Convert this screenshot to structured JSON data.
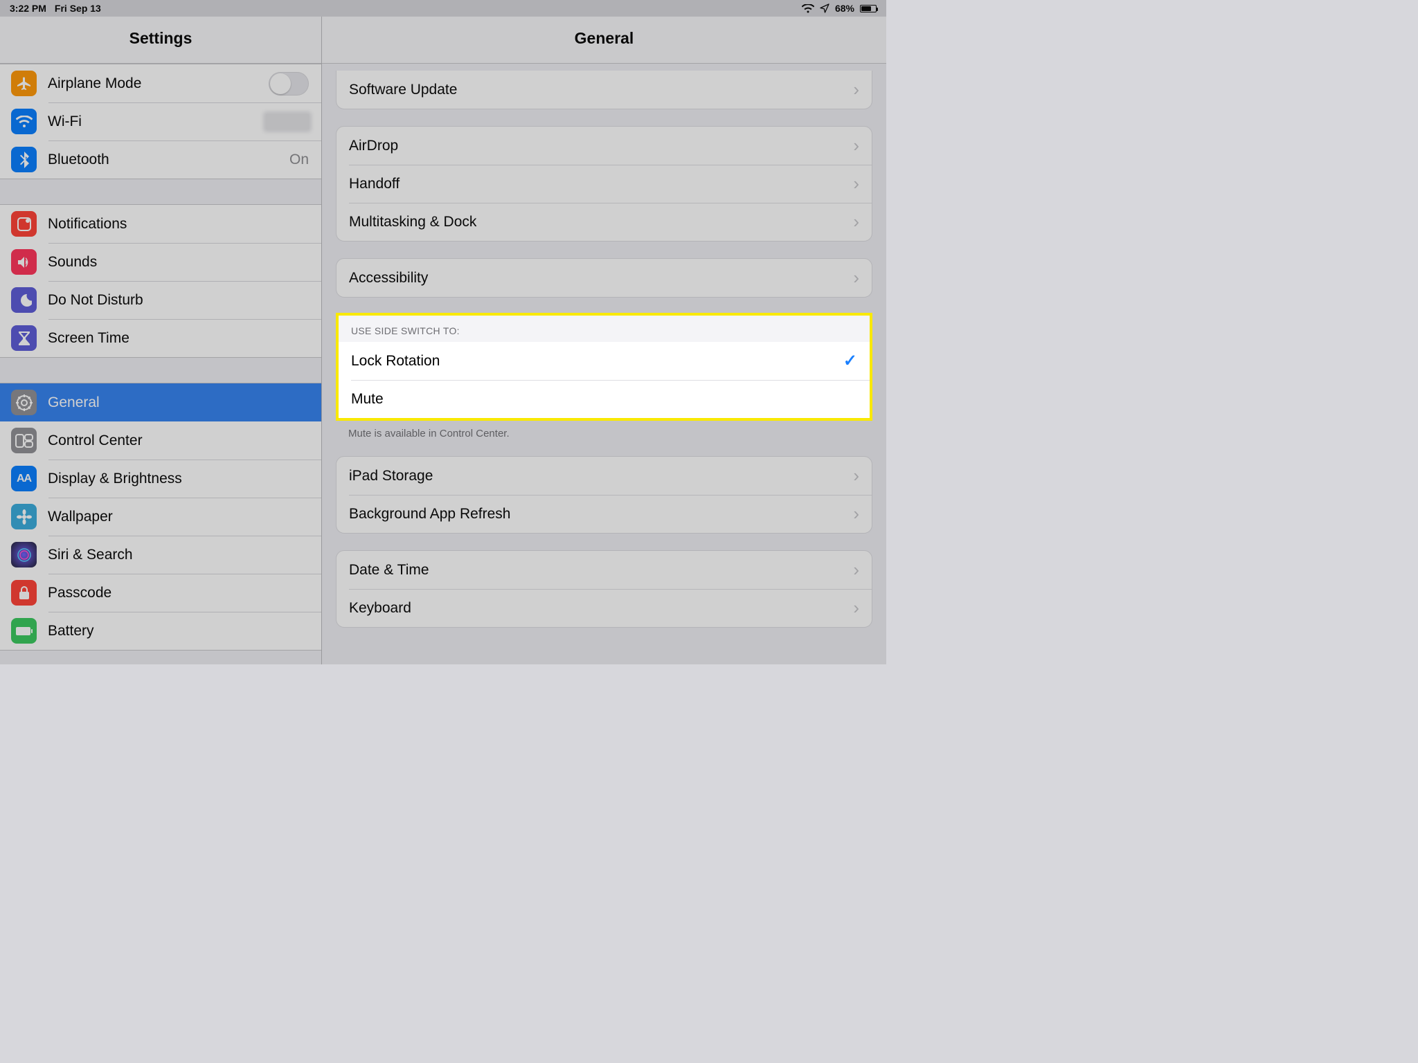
{
  "statusbar": {
    "time": "3:22 PM",
    "date": "Fri Sep 13",
    "battery": "68%"
  },
  "sidebar": {
    "title": "Settings",
    "groups": [
      {
        "rows": [
          {
            "icon": "airplane",
            "color": "bg-orange",
            "label": "Airplane Mode",
            "type": "toggle",
            "toggled": false
          },
          {
            "icon": "wifi",
            "color": "bg-blue",
            "label": "Wi-Fi",
            "type": "link",
            "value": "hidden"
          },
          {
            "icon": "bluetooth",
            "color": "bg-bt",
            "label": "Bluetooth",
            "type": "link",
            "value": "On"
          }
        ]
      },
      {
        "rows": [
          {
            "icon": "notifications",
            "color": "bg-red",
            "label": "Notifications",
            "type": "link"
          },
          {
            "icon": "sounds",
            "color": "bg-pink",
            "label": "Sounds",
            "type": "link"
          },
          {
            "icon": "dnd",
            "color": "bg-purple",
            "label": "Do Not Disturb",
            "type": "link"
          },
          {
            "icon": "screentime",
            "color": "bg-purple",
            "label": "Screen Time",
            "type": "link"
          }
        ]
      },
      {
        "rows": [
          {
            "icon": "general",
            "color": "bg-gray",
            "label": "General",
            "type": "link",
            "selected": true
          },
          {
            "icon": "controlcenter",
            "color": "bg-gray",
            "label": "Control Center",
            "type": "link"
          },
          {
            "icon": "display",
            "color": "bg-dblue",
            "label": "Display & Brightness",
            "type": "link"
          },
          {
            "icon": "wallpaper",
            "color": "bg-teal",
            "label": "Wallpaper",
            "type": "link"
          },
          {
            "icon": "siri",
            "color": "",
            "label": "Siri & Search",
            "type": "link"
          },
          {
            "icon": "passcode",
            "color": "bg-red",
            "label": "Passcode",
            "type": "link"
          },
          {
            "icon": "battery",
            "color": "bg-green",
            "label": "Battery",
            "type": "link"
          }
        ]
      }
    ]
  },
  "detail": {
    "title": "General",
    "groups": [
      {
        "type": "plain",
        "first": true,
        "rows": [
          {
            "label": "Software Update",
            "chevron": true
          }
        ]
      },
      {
        "type": "plain",
        "rows": [
          {
            "label": "AirDrop",
            "chevron": true
          },
          {
            "label": "Handoff",
            "chevron": true
          },
          {
            "label": "Multitasking & Dock",
            "chevron": true
          }
        ]
      },
      {
        "type": "plain",
        "rows": [
          {
            "label": "Accessibility",
            "chevron": true
          }
        ]
      },
      {
        "type": "highlight",
        "header": "USE SIDE SWITCH TO:",
        "footer": "Mute is available in Control Center.",
        "rows": [
          {
            "label": "Lock Rotation",
            "checked": true
          },
          {
            "label": "Mute"
          }
        ]
      },
      {
        "type": "plain",
        "rows": [
          {
            "label": "iPad Storage",
            "chevron": true
          },
          {
            "label": "Background App Refresh",
            "chevron": true
          }
        ]
      },
      {
        "type": "plain",
        "rows": [
          {
            "label": "Date & Time",
            "chevron": true
          },
          {
            "label": "Keyboard",
            "chevron": true
          }
        ]
      }
    ]
  },
  "icons": {
    "airplane": "✈",
    "wifi": "wifi",
    "bluetooth": "bt",
    "notifications": "▢",
    "sounds": "🔊",
    "dnd": "☾",
    "screentime": "⌛",
    "general": "⚙",
    "controlcenter": "cc",
    "display": "AA",
    "wallpaper": "❀",
    "siri": "siri",
    "passcode": "🔒",
    "battery": "▮"
  }
}
